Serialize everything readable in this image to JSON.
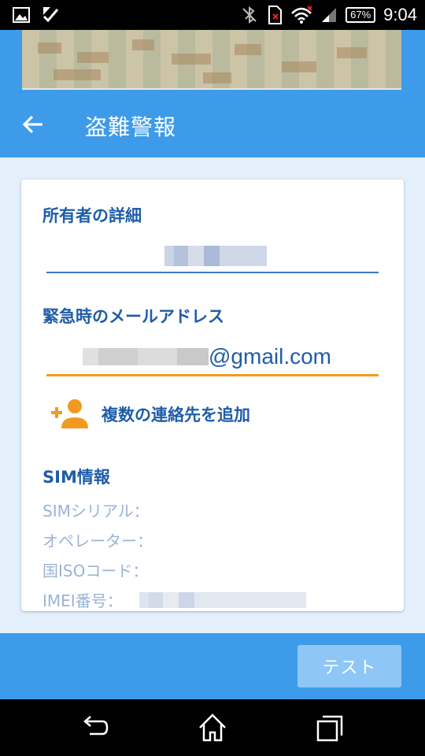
{
  "status_bar": {
    "time": "9:04",
    "battery": "67%",
    "icons": [
      "image-icon",
      "check-icon",
      "bluetooth-off-icon",
      "sim-card-icon",
      "wifi-icon",
      "signal-icon"
    ]
  },
  "app_bar": {
    "title": "盗難警報",
    "back_icon": "arrow-back-icon"
  },
  "owner": {
    "section_title": "所有者の詳細"
  },
  "emergency_email": {
    "section_title": "緊急時のメールアドレス",
    "visible_suffix": "@gmail.com"
  },
  "add_contacts": {
    "label": "複数の連絡先を追加",
    "icon": "person-add-icon"
  },
  "sim_info": {
    "section_title": "SIM情報",
    "rows": [
      {
        "label": "SIMシリアル："
      },
      {
        "label": "オペレーター："
      },
      {
        "label": "国ISOコード："
      },
      {
        "label": "IMEI番号："
      }
    ]
  },
  "footer": {
    "test_button": "テスト"
  },
  "colors": {
    "primary": "#3d9be9",
    "text_primary": "#1f5da8",
    "accent": "#f39a1e",
    "muted": "#9ab3d6",
    "background": "#e3f0fb",
    "test_button": "#8ec6f5"
  },
  "nav_bar": {
    "icons": [
      "back-icon",
      "home-icon",
      "recents-icon"
    ]
  }
}
